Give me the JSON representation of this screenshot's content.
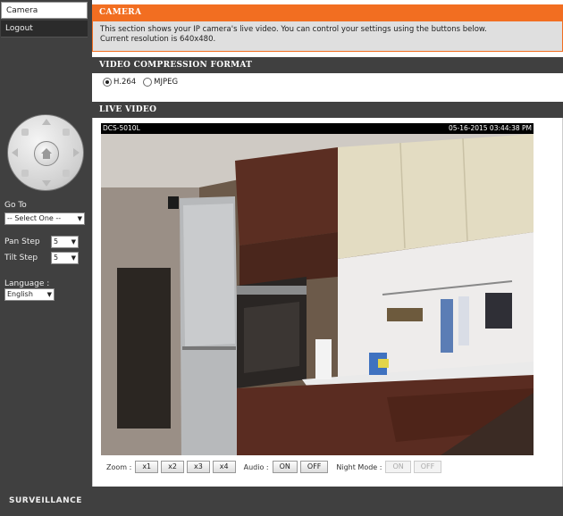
{
  "sidebar": {
    "tabs": [
      {
        "label": "Camera"
      },
      {
        "label": "Logout"
      }
    ],
    "goto_label": "Go To",
    "goto_select": "-- Select One --",
    "pan_step_label": "Pan Step",
    "pan_step_value": "5",
    "tilt_step_label": "Tilt Step",
    "tilt_step_value": "5",
    "language_label": "Language :",
    "language_value": "English"
  },
  "camera_panel": {
    "title": "CAMERA",
    "line1": "This section shows your IP camera's live video. You can control your settings using the buttons below.",
    "line2": "Current resolution is 640x480."
  },
  "compression_panel": {
    "title": "VIDEO COMPRESSION FORMAT",
    "options": [
      {
        "label": "H.264",
        "selected": true
      },
      {
        "label": "MJPEG",
        "selected": false
      }
    ]
  },
  "live_panel": {
    "title": "LIVE VIDEO",
    "camera_name": "DCS-5010L",
    "timestamp": "05-16-2015 03:44:38 PM"
  },
  "controls": {
    "zoom_label": "Zoom :",
    "zoom_buttons": [
      "x1",
      "x2",
      "x3",
      "x4"
    ],
    "audio_label": "Audio :",
    "audio_on": "ON",
    "audio_off": "OFF",
    "night_label": "Night Mode :",
    "night_on": "ON",
    "night_off": "OFF"
  },
  "footer": {
    "brand": "SURVEILLANCE"
  },
  "colors": {
    "accent": "#f26e21",
    "bar": "#404040"
  }
}
